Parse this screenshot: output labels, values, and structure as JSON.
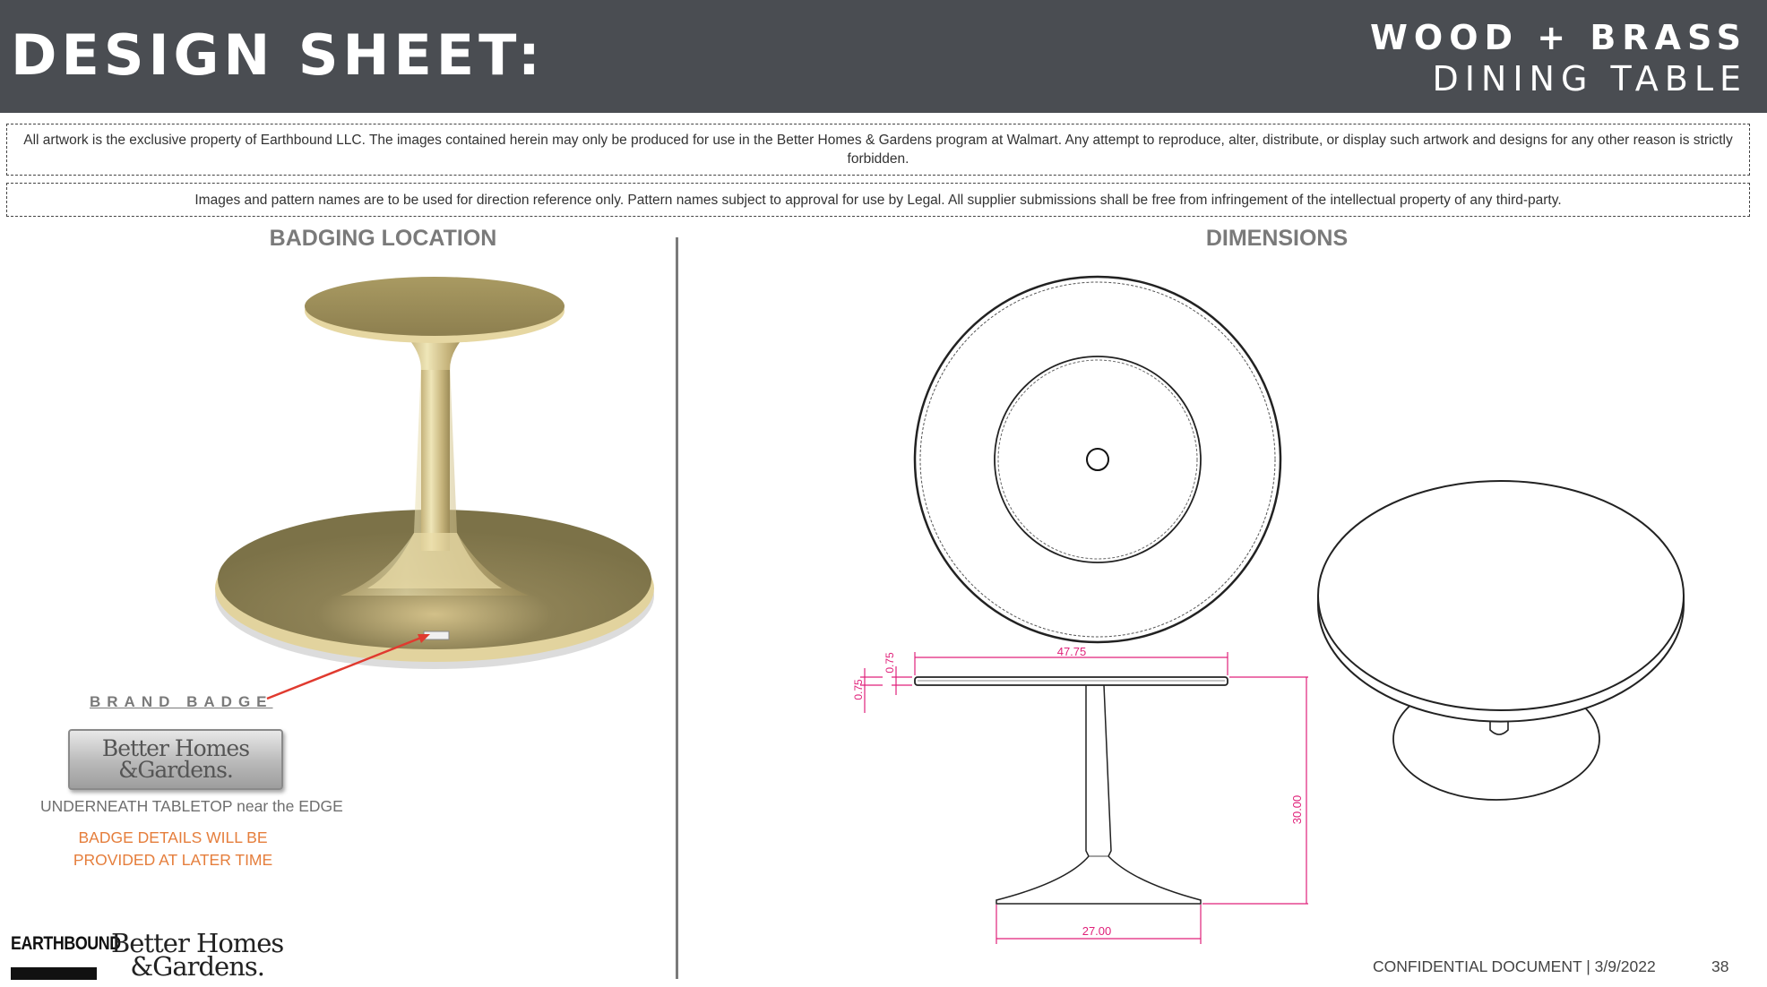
{
  "header": {
    "title": "DESIGN SHEET:",
    "product_line1": "WOOD + BRASS",
    "product_line2": "DINING TABLE"
  },
  "notices": {
    "ownership": "All artwork is the exclusive property of Earthbound LLC. The images contained herein may only be produced for use in the Better Homes & Gardens program at Walmart. Any attempt to reproduce, alter, distribute, or display such artwork and designs for any other reason is strictly forbidden.",
    "reference": "Images and pattern names are to be used for direction reference only.  Pattern names subject to approval for use by Legal. All supplier submissions shall be free from infringement of the intellectual property of any third-party."
  },
  "badging": {
    "heading": "BADGING LOCATION",
    "callout": "BRAND BADGE",
    "badge_logo_line1": "Better Homes",
    "badge_logo_line2": "&Gardens.",
    "placement": "UNDERNEATH TABLETOP near the EDGE",
    "details_line1": "BADGE DETAILS WILL BE",
    "details_line2": "PROVIDED AT LATER TIME",
    "colors": {
      "brass": "#b5a267",
      "callout_arrow": "#e03a2f",
      "details_text": "#e57e3c"
    }
  },
  "dimensions": {
    "heading": "DIMENSIONS",
    "top_thickness": "0.75",
    "edge_thickness": "0.75",
    "top_width": "47.75",
    "height": "30.00",
    "base_width": "27.00",
    "dim_color": "#e0217a"
  },
  "footer": {
    "brand1": "EARTHBOUND",
    "logo_line1": "Better Homes",
    "logo_line2": "&Gardens.",
    "confidential": "CONFIDENTIAL DOCUMENT | 3/9/2022",
    "page": "38"
  }
}
